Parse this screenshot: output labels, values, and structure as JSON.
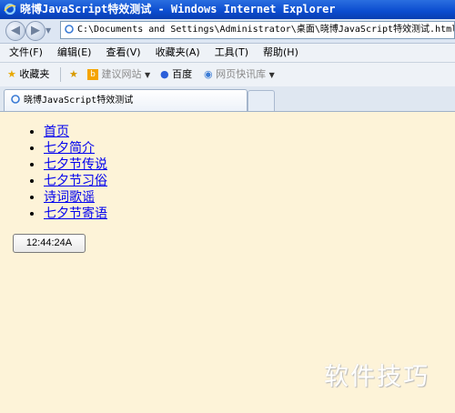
{
  "window": {
    "title": "晓博JavaScript特效测试 - Windows Internet Explorer"
  },
  "address_bar": {
    "url": "C:\\Documents and Settings\\Administrator\\桌面\\晓博JavaScript特效测试.html"
  },
  "menu": [
    "文件(F)",
    "编辑(E)",
    "查看(V)",
    "收藏夹(A)",
    "工具(T)",
    "帮助(H)"
  ],
  "favorites_bar": {
    "favorites_label": "收藏夹",
    "suggested_sites": "建议网站",
    "baidu": "百度",
    "web_slice": "网页快讯库"
  },
  "tab": {
    "title": "晓博JavaScript特效测试"
  },
  "page": {
    "nav_links": [
      "首页",
      "七夕简介",
      "七夕节传说",
      "七夕节习俗",
      "诗词歌谣",
      "七夕节寄语"
    ],
    "clock_text": "12:44:24A"
  },
  "watermark": "软件技巧",
  "colors": {
    "titlebar": "#0b4ccf",
    "page_background": "#fdf3d8",
    "link": "#0000ee"
  }
}
